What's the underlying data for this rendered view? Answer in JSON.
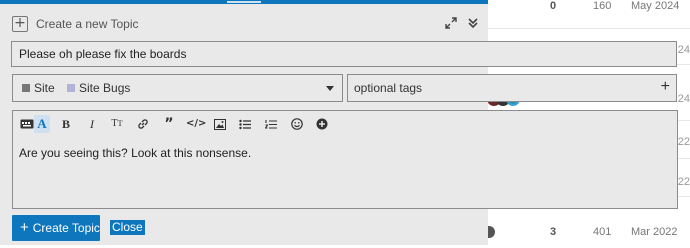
{
  "background_list": {
    "top_row": {
      "replies": "0",
      "views": "160",
      "date": "May 2024"
    },
    "bottom_row": {
      "replies": "3",
      "views": "401",
      "date": "Mar 2022"
    },
    "partial_years": [
      "24",
      "24",
      "22",
      "22",
      "22"
    ]
  },
  "composer": {
    "header_title": "Create a new Topic",
    "header_icons": [
      "plus-box-icon",
      "expand-icon",
      "chevrons-down-icon"
    ],
    "title_value": "Please oh please fix the boards",
    "category": {
      "parent": "Site",
      "parent_color": "#777777",
      "child": "Site Bugs",
      "child_color": "#b3b3d9"
    },
    "tags_placeholder": "optional tags",
    "tags_add_glyph": "+",
    "toolbar": {
      "items": [
        "toggle-editor",
        "font",
        "bold",
        "italic",
        "heading",
        "link",
        "quote",
        "code",
        "image",
        "bullet-list",
        "numbered-list",
        "emoji",
        "options"
      ]
    },
    "editor_text": "Are you seeing this? Look at this nonsense.",
    "create_label": "Create Topic",
    "create_glyph": "+",
    "close_label": "Close",
    "accent": "#0e76bd"
  }
}
